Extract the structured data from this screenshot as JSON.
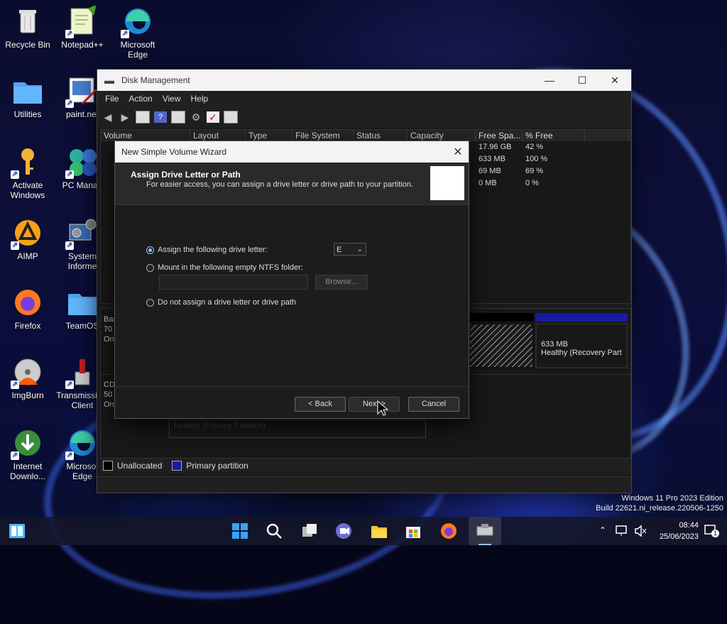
{
  "desktop": {
    "icons": [
      {
        "label": "Recycle Bin",
        "icon": "recycle-bin-icon"
      },
      {
        "label": "Notepad++",
        "icon": "notepad-plus-plus-icon"
      },
      {
        "label": "Microsoft Edge",
        "icon": "edge-icon"
      },
      {
        "label": "Utilities",
        "icon": "folder-icon"
      },
      {
        "label": "paint.net",
        "icon": "paint-net-icon"
      },
      {
        "label": "Activate Windows",
        "icon": "key-icon"
      },
      {
        "label": "PC Manag",
        "icon": "pc-manager-icon"
      },
      {
        "label": "AIMP",
        "icon": "aimp-icon"
      },
      {
        "label": "System Informe",
        "icon": "system-info-icon"
      },
      {
        "label": "Firefox",
        "icon": "firefox-icon"
      },
      {
        "label": "TeamOS",
        "icon": "folder-icon"
      },
      {
        "label": "ImgBurn",
        "icon": "imgburn-icon"
      },
      {
        "label": "Transmissi Qt Client",
        "icon": "transmission-icon"
      },
      {
        "label": "Internet Downlo...",
        "icon": "idm-icon"
      },
      {
        "label": "Microsof Edge",
        "icon": "edge-icon"
      }
    ]
  },
  "disk_management": {
    "title": "Disk Management",
    "menu": [
      "File",
      "Action",
      "View",
      "Help"
    ],
    "columns": [
      "Volume",
      "Layout",
      "Type",
      "File System",
      "Status",
      "Capacity",
      "Free Spa...",
      "% Free"
    ],
    "rows": [
      {
        "free": "17.96 GB",
        "pct": "42 %"
      },
      {
        "free": "633 MB",
        "pct": "100 %"
      },
      {
        "free": "69 MB",
        "pct": "69 %"
      },
      {
        "free": "0 MB",
        "pct": "0 %"
      }
    ],
    "disk0_labels": [
      "Bas",
      "70",
      "On"
    ],
    "disk1_labels": [
      "CD",
      "50",
      "Onli"
    ],
    "recovery_size": "633 MB",
    "recovery_status": "Healthy (Recovery Part",
    "primary_status": "Healthy (Primary Partition)",
    "legend": {
      "unallocated": "Unallocated",
      "primary": "Primary partition"
    }
  },
  "wizard": {
    "title": "New Simple Volume Wizard",
    "heading": "Assign Drive Letter or Path",
    "subheading": "For easier access, you can assign a drive letter or drive path to your partition.",
    "option_assign": "Assign the following drive letter:",
    "drive_letter": "E",
    "option_mount": "Mount in the following empty NTFS folder:",
    "browse_label": "Browse...",
    "option_none": "Do not assign a drive letter or drive path",
    "back_label": "< Back",
    "next_label": "Next >",
    "cancel_label": "Cancel"
  },
  "watermark": {
    "line1": "Windows 11 Pro 2023 Edition",
    "line2": "Build 22621.ni_release.220506-1250"
  },
  "taskbar": {
    "time": "08:44",
    "date": "25/06/2023",
    "notification_count": "1"
  },
  "colors": {
    "accent": "#8fc3ff",
    "primary_partition": "#1a1aa0"
  }
}
